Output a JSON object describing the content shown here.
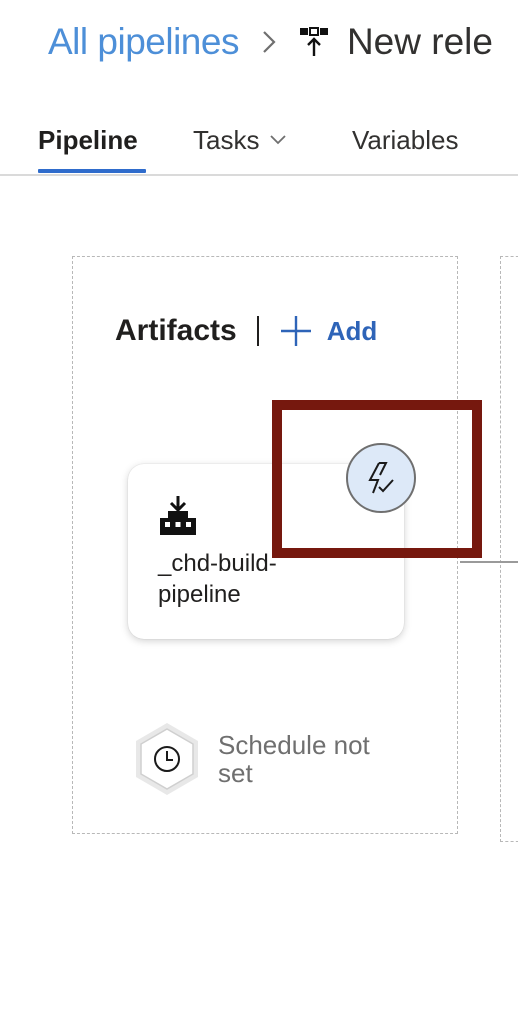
{
  "breadcrumb": {
    "parent_label": "All pipelines",
    "separator_icon": "chevron-right-icon",
    "pipeline_icon": "release-pipeline-icon",
    "title": "New rele"
  },
  "tabs": [
    {
      "label": "Pipeline",
      "active": true
    },
    {
      "label": "Tasks",
      "has_dropdown": true
    },
    {
      "label": "Variables"
    }
  ],
  "artifacts": {
    "title": "Artifacts",
    "add_label": "Add",
    "add_icon": "plus-icon",
    "card": {
      "icon": "build-artifact-icon",
      "name": "_chd-build-pipeline"
    },
    "trigger_icon": "continuous-deployment-trigger-icon",
    "schedule": {
      "icon": "clock-icon",
      "text": "Schedule not set"
    }
  },
  "colors": {
    "link": "#4d8fd8",
    "accent": "#2f6ccc",
    "add": "#2e64b8",
    "highlight": "#76180e",
    "trigger_bg": "#dde9f8"
  }
}
